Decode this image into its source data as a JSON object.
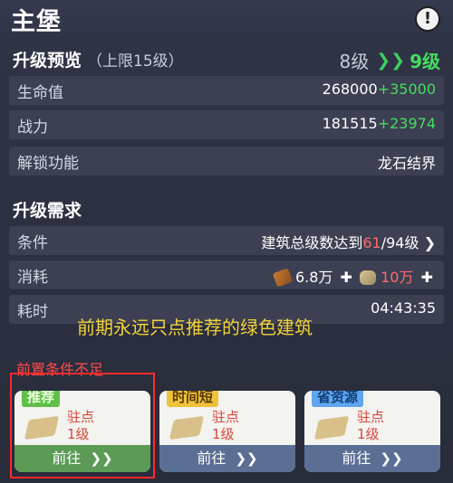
{
  "header": {
    "title": "主堡",
    "info_icon": "exclamation-icon"
  },
  "preview": {
    "title": "升级预览",
    "limit": "（上限15级）",
    "from_level": "8级",
    "arrow": "❯❯",
    "to_level": "9级",
    "rows": [
      {
        "label": "生命值",
        "base": "268000",
        "gain": "+35000"
      },
      {
        "label": "战力",
        "base": "181515",
        "gain": "+23974"
      },
      {
        "label": "解锁功能",
        "base": "龙石结界",
        "gain": ""
      }
    ]
  },
  "requirements": {
    "title": "升级需求",
    "condition_label": "条件",
    "condition_text": "建筑总级数达到",
    "condition_current": "61",
    "condition_target": "/94级",
    "consume_label": "消耗",
    "wood_amount": "6.8万",
    "stone_amount": "10万",
    "plus": "✚",
    "time_label": "耗时",
    "time_value": "04:43:35"
  },
  "annotation": "前期永远只点推荐的绿色建筑",
  "warning": "前置条件不足",
  "cards": [
    {
      "tag": "推荐",
      "name": "驻点",
      "level": "1级",
      "go": "前往"
    },
    {
      "tag": "时间短",
      "name": "驻点",
      "level": "1级",
      "go": "前往"
    },
    {
      "tag": "省资源",
      "name": "驻点",
      "level": "1级",
      "go": "前往"
    }
  ],
  "colors": {
    "accent_green": "#45dc5f",
    "warn_red": "#ff4a4a",
    "annotation_yellow": "#f2d13a"
  }
}
